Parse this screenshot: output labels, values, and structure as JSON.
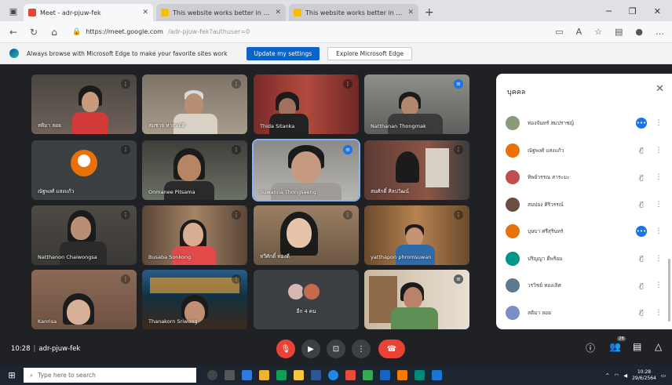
{
  "browser": {
    "tabs": [
      {
        "title": "Meet - adr-pjuw-fek",
        "favicon_color": "#ea4335",
        "active": true
      },
      {
        "title": "This website works better in Micr",
        "favicon_color": "#fbbc04",
        "active": false
      },
      {
        "title": "This website works better in Micr",
        "favicon_color": "#fbbc04",
        "active": false
      }
    ],
    "url_host": "https://meet.google.com",
    "url_path": "/adr-pjuw-fek?authuser=0"
  },
  "infobar": {
    "message": "Always browse with Microsoft Edge to make your favorite sites work",
    "primary_button": "Update my settings",
    "secondary_button": "Explore Microsoft Edge"
  },
  "tiles": [
    {
      "name": "สติมา ลอย",
      "mic": "muted"
    },
    {
      "name": "สมชาย หาสมบัติ",
      "mic": "muted"
    },
    {
      "name": "Thida Sitanka",
      "mic": "muted"
    },
    {
      "name": "Natthanan Thongmak",
      "mic": "speaking"
    },
    {
      "name": "ณัฐพงศ์ แสงแก้ว",
      "mic": "muted"
    },
    {
      "name": "Onmanee Pitsama",
      "mic": "muted"
    },
    {
      "name": "Suwanna Thongsaeng",
      "mic": "speaking"
    },
    {
      "name": "สมศักดิ์ ศิลปวัฒน์",
      "mic": "muted"
    },
    {
      "name": "Natthanon Chaiwongsa",
      "mic": "muted"
    },
    {
      "name": "Busaba Sonkong",
      "mic": "muted"
    },
    {
      "name": "ทวีศักดิ์ ทองดี",
      "mic": "muted"
    },
    {
      "name": "yatthapon phromsuwan",
      "mic": "muted"
    },
    {
      "name": "Kanrisa",
      "mic": "muted"
    },
    {
      "name": "Thanakorn Sriwong",
      "mic": "muted"
    },
    {
      "name": "อีก 4 คน",
      "mic": "none"
    },
    {
      "name": "",
      "mic": "speaking"
    }
  ],
  "people_panel": {
    "title": "บุคคล",
    "people": [
      {
        "name": "ทองจันทร์ สมปราชญ์",
        "mic": "speaking",
        "avatar_color": "#8a9a7b"
      },
      {
        "name": "ณัฐพงศ์ แสงแก้ว",
        "mic": "muted",
        "avatar_color": "#e8710a"
      },
      {
        "name": "ทิพย์วรรณ สาระมะ",
        "mic": "muted",
        "avatar_color": "#c0504d"
      },
      {
        "name": "สมปอง ศิริวรรณ์",
        "mic": "muted",
        "avatar_color": "#6d4c41"
      },
      {
        "name": "บุษบา ศรีสุรินทร์",
        "mic": "speaking",
        "avatar_color": "#e8710a"
      },
      {
        "name": "ปริญญา ดีพร้อม",
        "mic": "muted",
        "avatar_color": "#009688"
      },
      {
        "name": "วรวิชย์ ทองเลิศ",
        "mic": "muted",
        "avatar_color": "#5e7a8c"
      },
      {
        "name": "สติมา ลอย",
        "mic": "muted",
        "avatar_color": "#7a8fc6"
      }
    ]
  },
  "controls": {
    "time": "10:28",
    "meeting_code": "adr-pjuw-fek",
    "participant_count": "26"
  },
  "taskbar": {
    "search_placeholder": "Type here to search",
    "clock_time": "10:28",
    "clock_date": "29/6/2564"
  }
}
